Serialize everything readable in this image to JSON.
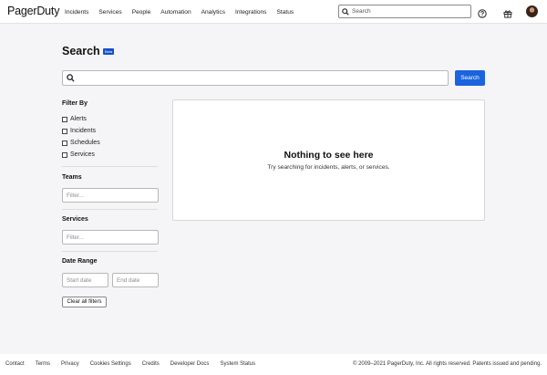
{
  "brand": {
    "name": "PagerDuty"
  },
  "nav": {
    "links": [
      "Incidents",
      "Services",
      "People",
      "Automation",
      "Analytics",
      "Integrations",
      "Status"
    ],
    "search_placeholder": "Search",
    "icons": [
      "search-icon",
      "help-icon",
      "gift-icon",
      "avatar"
    ]
  },
  "page": {
    "title": "Search",
    "badge": "Beta",
    "search_value": "",
    "search_button": "Search"
  },
  "sidebar": {
    "filter_by": "Filter By",
    "types": [
      "Alerts",
      "Incidents",
      "Schedules",
      "Services"
    ],
    "teams_heading": "Teams",
    "teams_placeholder": "Filter...",
    "services_heading": "Services",
    "services_placeholder": "Filter...",
    "date_range_heading": "Date Range",
    "start_placeholder": "Start date",
    "end_placeholder": "End date",
    "clear_button": "Clear all filters"
  },
  "results": {
    "empty_title": "Nothing to see here",
    "empty_subtitle": "Try searching for incidents, alerts, or services."
  },
  "footer": {
    "links": [
      "Contact",
      "Terms",
      "Privacy",
      "Cookies Settings",
      "Credits",
      "Developer Docs",
      "System Status"
    ],
    "copyright": "© 2009–2021 PagerDuty, Inc. All rights reserved. Patents issued and pending."
  },
  "colors": {
    "accent": "#1b63df",
    "badge": "#1551c7",
    "background": "#f5f5f7"
  }
}
